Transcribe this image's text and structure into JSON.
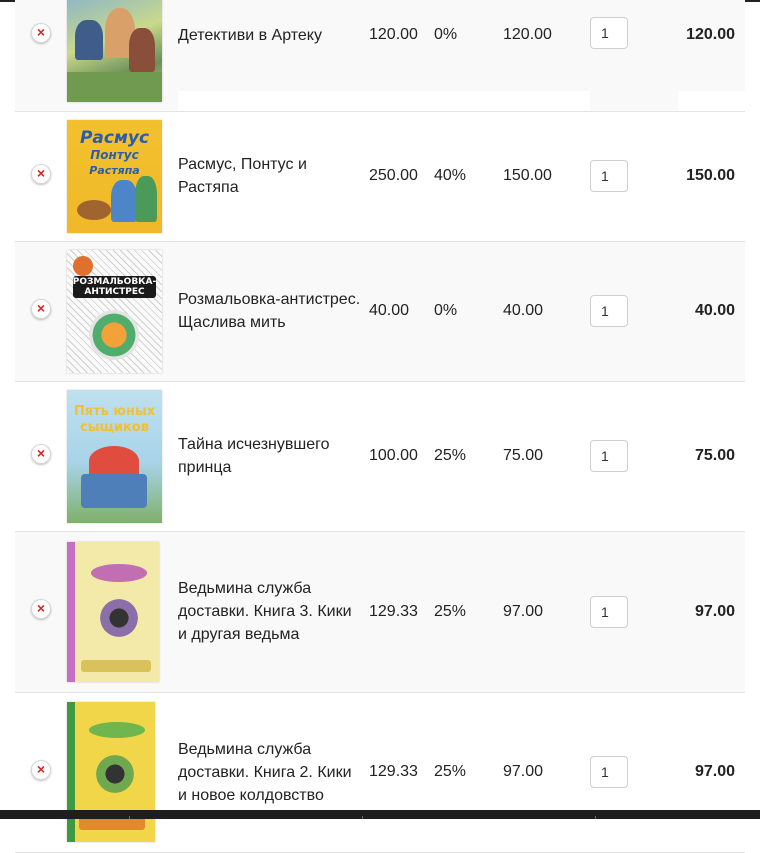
{
  "cart": {
    "rows": [
      {
        "name": "Детективи в Артеку",
        "price": "120.00",
        "discount": "0%",
        "final": "120.00",
        "qty": "1",
        "total": "120.00",
        "cover": "book-cover-detektivy-image"
      },
      {
        "name": "Расмус, Понтус и Растяпа",
        "price": "250.00",
        "discount": "40%",
        "final": "150.00",
        "qty": "1",
        "total": "150.00",
        "cover": "book-cover-rasmus-image",
        "cover_text": [
          "Расмус",
          "Понтус",
          "Растяпа"
        ]
      },
      {
        "name": "Розмальовка-антистрес. Щаслива мить",
        "price": "40.00",
        "discount": "0%",
        "final": "40.00",
        "qty": "1",
        "total": "40.00",
        "cover": "book-cover-rozmalovka-image",
        "cover_text": [
          "РОЗМАЛЬОВКА-",
          "АНТИСТРЕС"
        ]
      },
      {
        "name": "Тайна исчезнувшего принца",
        "price": "100.00",
        "discount": "25%",
        "final": "75.00",
        "qty": "1",
        "total": "75.00",
        "cover": "book-cover-tayna-image",
        "cover_text": [
          "Пять юных",
          "сыщиков"
        ]
      },
      {
        "name": "Ведьмина служба доставки. Книга 3. Кики и другая ведьма",
        "price": "129.33",
        "discount": "25%",
        "final": "97.00",
        "qty": "1",
        "total": "97.00",
        "cover": "book-cover-kiki3-image"
      },
      {
        "name": "Ведьмина служба доставки. Книга 2. Кики и новое колдовство",
        "price": "129.33",
        "discount": "25%",
        "final": "97.00",
        "qty": "1",
        "total": "97.00",
        "cover": "book-cover-kiki2-image"
      }
    ]
  },
  "colors": {
    "remove_icon": "#e02020",
    "row_alt": "#f9f9f9",
    "row_border": "#e4e4e4",
    "bottom_bar": "#1e1e1e"
  }
}
